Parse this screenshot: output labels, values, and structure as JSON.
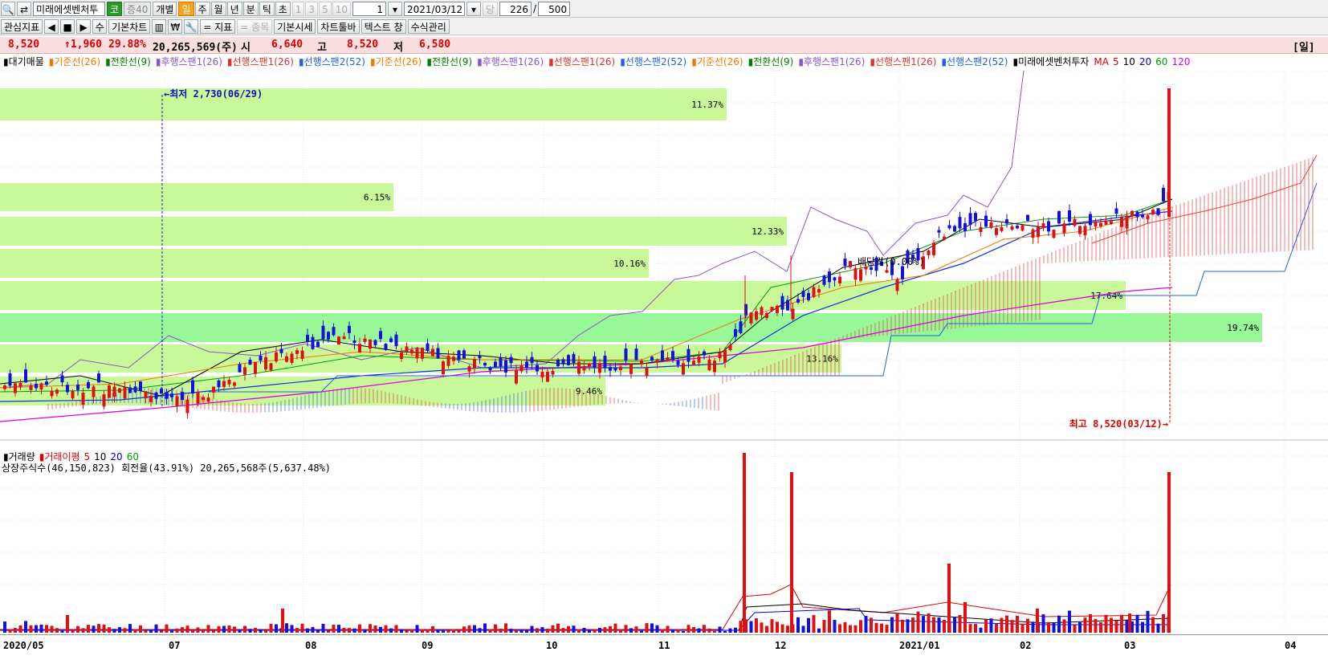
{
  "toolbar1": {
    "stock_name": "미래에셋벤처투",
    "market_badge": "코",
    "margin_badge": "증40",
    "mode_individual": "개별",
    "periods": [
      "일",
      "주",
      "월",
      "년",
      "분",
      "틱",
      "초"
    ],
    "active_period": "일",
    "intervals": [
      "1",
      "3",
      "5",
      "10"
    ],
    "count_value": "1",
    "date_value": "2021/03/12",
    "dang_label": "당",
    "bar_count": "226",
    "slash": "/",
    "bar_total": "500"
  },
  "toolbar2": {
    "watchlist": "관심지표",
    "basic_chart": "기본차트",
    "won_symbol": "₩",
    "indicator": "= 지표",
    "stock": "= 종목",
    "basic_quote": "기본시세",
    "chart_toolbar": "차트툴바",
    "text_window": "텍스트 창",
    "formula_manage": "수식관리",
    "su_label": "수"
  },
  "quote": {
    "price": "8,520",
    "change": "↑1,960",
    "change_pct": "29.88%",
    "volume": "20,265,569(주)",
    "open_label": "시",
    "open": "6,640",
    "high_label": "고",
    "high": "8,520",
    "low_label": "저",
    "low": "6,580",
    "right_tag": "[일]"
  },
  "legend": [
    {
      "text": "대기매물",
      "color": "#000000"
    },
    {
      "text": "기준선(26)",
      "color": "#f07800"
    },
    {
      "text": "전환선(9)",
      "color": "#008000"
    },
    {
      "text": "후행스팬1(26)",
      "color": "#9050d0"
    },
    {
      "text": "선행스팬1(26)",
      "color": "#e03030"
    },
    {
      "text": "선행스팬2(52)",
      "color": "#2060e0"
    },
    {
      "text": "기준선(26)",
      "color": "#f07800"
    },
    {
      "text": "전환선(9)",
      "color": "#008000"
    },
    {
      "text": "후행스팬1(26)",
      "color": "#9050d0"
    },
    {
      "text": "선행스팬1(26)",
      "color": "#e03030"
    },
    {
      "text": "선행스팬2(52)",
      "color": "#2060e0"
    },
    {
      "text": "기준선(26)",
      "color": "#f07800"
    },
    {
      "text": "전환선(9)",
      "color": "#008000"
    },
    {
      "text": "후행스팬1(26)",
      "color": "#9050d0"
    },
    {
      "text": "선행스팬1(26)",
      "color": "#e03030"
    },
    {
      "text": "선행스팬2(52)",
      "color": "#2060e0"
    },
    {
      "text": "미래에셋벤처투자",
      "color": "#000000"
    },
    {
      "text": "MA",
      "color": "#e00000"
    },
    {
      "text": "5",
      "color": "#e00000"
    },
    {
      "text": "10",
      "color": "#000000"
    },
    {
      "text": "20",
      "color": "#0000e0"
    },
    {
      "text": "60",
      "color": "#00a000"
    },
    {
      "text": "120",
      "color": "#e000e0"
    }
  ],
  "annotations": {
    "lowest": "최저 2,730(06/29)",
    "highest": "최고 8,520(03/12)",
    "dividend": "배당락(0.00%)"
  },
  "profile_bands": [
    {
      "label": "11.37%",
      "pct": 11.37,
      "highlight": false
    },
    {
      "label": "6.15%",
      "pct": 6.15,
      "highlight": false
    },
    {
      "label": "12.33%",
      "pct": 12.33,
      "highlight": false
    },
    {
      "label": "10.16%",
      "pct": 10.16,
      "highlight": false
    },
    {
      "label": "17.64%",
      "pct": 17.64,
      "highlight": false
    },
    {
      "label": "19.74%",
      "pct": 19.74,
      "highlight": true
    },
    {
      "label": "13.16%",
      "pct": 13.16,
      "highlight": false
    },
    {
      "label": "9.46%",
      "pct": 9.46,
      "highlight": false
    }
  ],
  "volume_panel": {
    "legend": [
      {
        "text": "거래량",
        "color": "#000000"
      },
      {
        "text": "거래이평",
        "color": "#e00000"
      },
      {
        "text": "5",
        "color": "#e00000"
      },
      {
        "text": "10",
        "color": "#000000"
      },
      {
        "text": "20",
        "color": "#0000e0"
      },
      {
        "text": "60",
        "color": "#00a000"
      }
    ],
    "info": "상장주식수(46,150,823) 회전율(43.91%) 20,265,568주(5,637.48%)"
  },
  "x_axis": [
    "2020/05",
    "07",
    "08",
    "09",
    "10",
    "11",
    "12",
    "2021/01",
    "02",
    "03",
    "04"
  ],
  "colors": {
    "up": "#e01010",
    "down": "#1010e0",
    "band": "#c8f898",
    "band_highlight": "#98f898"
  }
}
